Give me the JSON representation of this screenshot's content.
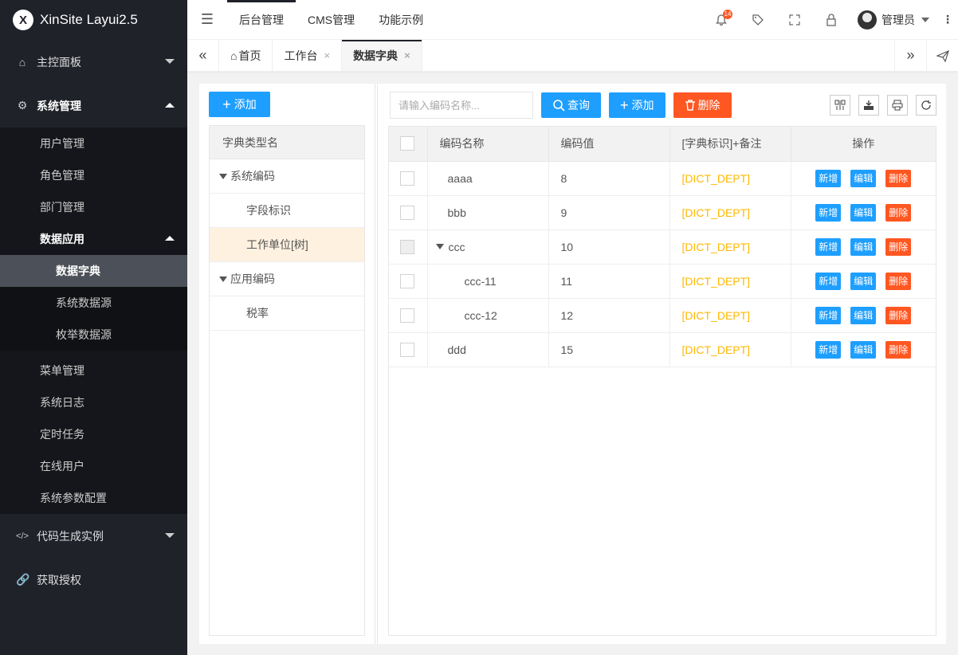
{
  "app": {
    "title": "XinSite Layui2.5",
    "logo_glyph": "X"
  },
  "sidebar": {
    "items": [
      {
        "label": "主控面板",
        "icon": "home-icon"
      },
      {
        "label": "系统管理",
        "icon": "gear-icon"
      },
      {
        "label": "代码生成实例",
        "icon": "code-icon"
      },
      {
        "label": "获取授权",
        "icon": "link-icon"
      }
    ],
    "system_sub": {
      "users": "用户管理",
      "roles": "角色管理",
      "depts": "部门管理",
      "data_app": "数据应用",
      "data_app_sub": [
        "数据字典",
        "系统数据源",
        "枚举数据源"
      ],
      "menus": "菜单管理",
      "logs": "系统日志",
      "tasks": "定时任务",
      "online": "在线用户",
      "params": "系统参数配置"
    }
  },
  "header": {
    "menus": [
      "后台管理",
      "CMS管理",
      "功能示例"
    ],
    "badge_count": "14",
    "username": "管理员"
  },
  "tabs": {
    "home": "首页",
    "workbench": "工作台",
    "current": "数据字典",
    "close": "×"
  },
  "tree": {
    "add_label": "添加",
    "header": "字典类型名",
    "groups": [
      {
        "label": "系统编码",
        "children": [
          "字段标识",
          "工作单位[树]"
        ]
      },
      {
        "label": "应用编码",
        "children": [
          "税率"
        ]
      }
    ]
  },
  "toolbar": {
    "search_placeholder": "请输入编码名称...",
    "query": "查询",
    "add": "添加",
    "delete": "删除"
  },
  "grid": {
    "columns": [
      "编码名称",
      "编码值",
      "[字典标识]+备注",
      "操作"
    ],
    "rows": [
      {
        "name": "aaaa",
        "value": "8",
        "dict": "[DICT_DEPT]"
      },
      {
        "name": "bbb",
        "value": "9",
        "dict": "[DICT_DEPT]"
      },
      {
        "name": "ccc",
        "value": "10",
        "dict": "[DICT_DEPT]"
      },
      {
        "name": "ccc-11",
        "value": "11",
        "dict": "[DICT_DEPT]"
      },
      {
        "name": "ccc-12",
        "value": "12",
        "dict": "[DICT_DEPT]"
      },
      {
        "name": "ddd",
        "value": "15",
        "dict": "[DICT_DEPT]"
      }
    ],
    "actions": {
      "add": "新增",
      "edit": "编辑",
      "delete": "删除"
    }
  },
  "colors": {
    "sidebar": "#20222a",
    "blue": "#1e9fff",
    "red": "#ff5722",
    "dict": "#ffb800"
  }
}
